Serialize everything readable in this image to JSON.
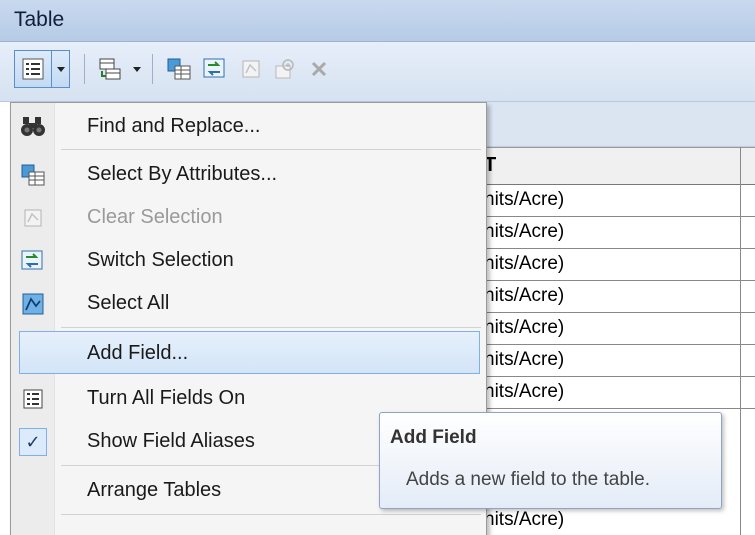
{
  "window": {
    "title": "Table"
  },
  "toolbar": {
    "buttons": [
      {
        "icon": "table-options-icon"
      },
      {
        "icon": "related-tables-icon"
      },
      {
        "icon": "select-by-attributes-icon"
      },
      {
        "icon": "switch-selection-icon"
      },
      {
        "icon": "clear-selection-icon"
      },
      {
        "icon": "zoom-to-selected-icon"
      },
      {
        "icon": "delete-selected-icon"
      }
    ]
  },
  "table": {
    "header_fragment": "T",
    "rows": [
      "nits/Acre)",
      "nits/Acre)",
      "nits/Acre)",
      "nits/Acre)",
      "nits/Acre)",
      "nits/Acre)",
      "nits/Acre)",
      "nits/Acre)"
    ]
  },
  "menu": {
    "items": [
      {
        "label": "Find and Replace...",
        "icon": "binoculars-icon",
        "disabled": false
      },
      {
        "label": "Select By Attributes...",
        "icon": "select-by-attributes-icon",
        "disabled": false
      },
      {
        "label": "Clear Selection",
        "icon": "clear-selection-icon",
        "disabled": true
      },
      {
        "label": "Switch Selection",
        "icon": "switch-selection-icon",
        "disabled": false
      },
      {
        "label": "Select All",
        "icon": "select-all-icon",
        "disabled": false
      },
      {
        "label": "Add Field...",
        "icon": "",
        "highlighted": true
      },
      {
        "label": "Turn All Fields On",
        "icon": "field-list-icon",
        "disabled": false
      },
      {
        "label": "Show Field Aliases",
        "icon": "checkmark-icon",
        "checked": true
      },
      {
        "label": "Arrange Tables",
        "icon": "",
        "disabled": false
      }
    ]
  },
  "tooltip": {
    "title": "Add Field",
    "body": "Adds a new field to the table."
  },
  "colors": {
    "highlight": "#d3e5f8",
    "highlight_border": "#7fb0e6",
    "titlebar": "#bfd2ea"
  }
}
